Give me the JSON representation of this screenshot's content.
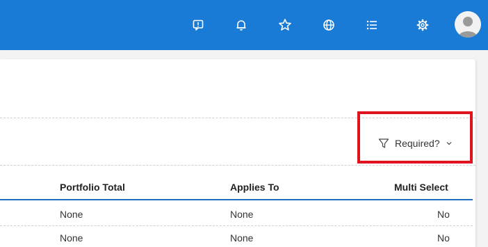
{
  "topbar": {
    "icons": [
      "feedback-icon",
      "bell-icon",
      "star-icon",
      "globe-icon",
      "list-icon",
      "gear-icon"
    ],
    "background": "#1a7bd6"
  },
  "filter": {
    "label": "Required?",
    "highlight_color": "#e0141e"
  },
  "table": {
    "headers": [
      "Portfolio Total",
      "Applies To",
      "Multi Select"
    ],
    "rows": [
      [
        "None",
        "None",
        "No"
      ],
      [
        "None",
        "None",
        "No"
      ]
    ]
  }
}
